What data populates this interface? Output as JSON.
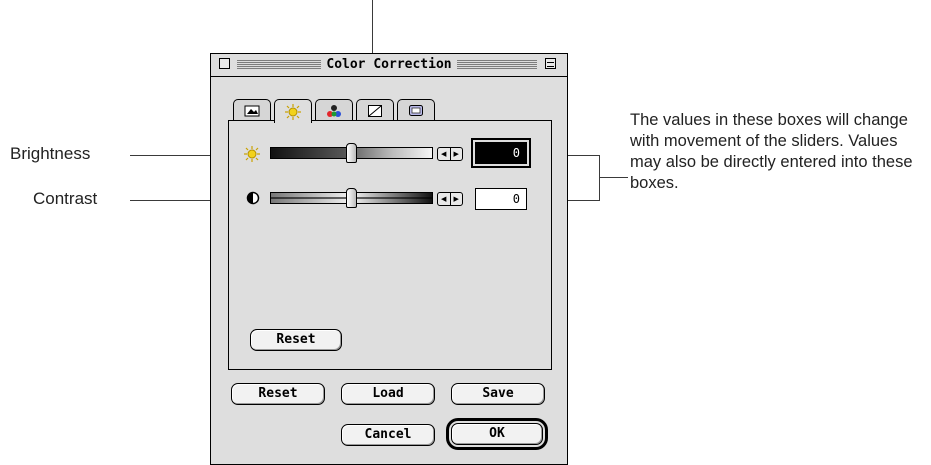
{
  "window": {
    "title": "Color Correction",
    "tabs": [
      {
        "name": "image-icon",
        "active": false
      },
      {
        "name": "sun-icon",
        "active": true
      },
      {
        "name": "color-dots-icon",
        "active": false
      },
      {
        "name": "curve-icon",
        "active": false
      },
      {
        "name": "monitor-icon",
        "active": false
      }
    ],
    "brightness": {
      "icon": "sun-icon",
      "value": "0",
      "slider_position": 0.5
    },
    "contrast": {
      "icon": "contrast-icon",
      "value": "0",
      "slider_position": 0.5
    },
    "panel_reset_label": "Reset",
    "buttons": {
      "reset": "Reset",
      "load": "Load",
      "save": "Save",
      "cancel": "Cancel",
      "ok": "OK"
    }
  },
  "callouts": {
    "brightness": "Brightness",
    "contrast": "Contrast",
    "values_note": "The values in these boxes will change with movement of the sliders. Values may also be directly entered into these boxes."
  },
  "colors": {
    "window_bg": "#dedede",
    "sun": "#f2d21b"
  }
}
